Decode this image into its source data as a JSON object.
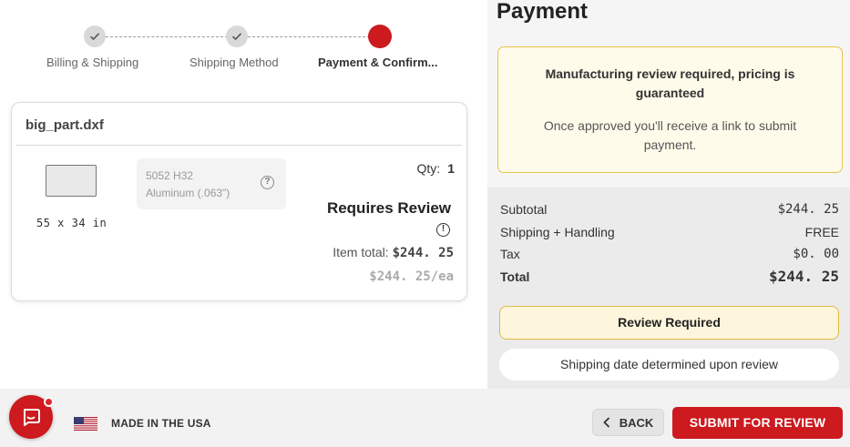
{
  "stepper": {
    "steps": [
      {
        "label": "Billing & Shipping",
        "state": "complete"
      },
      {
        "label": "Shipping Method",
        "state": "complete"
      },
      {
        "label": "Payment & Confirm...",
        "state": "active"
      }
    ]
  },
  "part": {
    "filename": "big_part.dxf",
    "dimensions": "55 x 34 in",
    "material_line1": "5052 H32",
    "material_line2": "Aluminum (.063\")",
    "help_icon": "question-icon",
    "qty_label": "Qty:",
    "qty_value": "1",
    "status": "Requires Review",
    "status_icon": "alert-circle-icon",
    "item_total_label": "Item total:",
    "item_total_value": "$244. 25",
    "price_each": "$244. 25/ea"
  },
  "payment": {
    "title": "Payment",
    "notice_title": "Manufacturing review required, pricing is guaranteed",
    "notice_body": "Once approved you'll receive a link to submit payment.",
    "summary": [
      {
        "label": "Subtotal",
        "value": "$244. 25"
      },
      {
        "label": "Shipping + Handling",
        "value": "FREE"
      },
      {
        "label": "Tax",
        "value": "$0. 00"
      },
      {
        "label": "Total",
        "value": "$244. 25"
      }
    ],
    "review_button": "Review Required",
    "shipping_note": "Shipping date determined upon review"
  },
  "footer": {
    "made_in": "MADE IN THE USA",
    "back_label": "BACK",
    "submit_label": "SUBMIT FOR REVIEW",
    "chat_icon": "chat-icon",
    "flag_icon": "us-flag-icon"
  },
  "colors": {
    "brand_red": "#cc1a1f",
    "notice_bg": "#fefbea",
    "notice_border": "#e5c44a"
  }
}
